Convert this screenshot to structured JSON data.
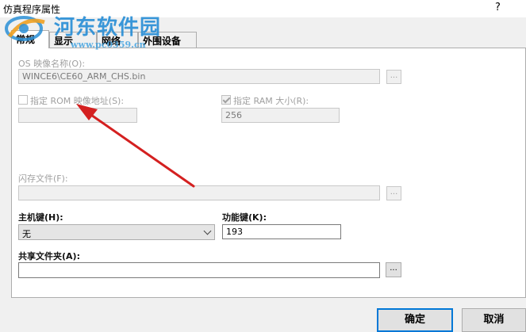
{
  "window": {
    "title": "仿真程序属性",
    "help_label": "?"
  },
  "watermark": {
    "text": "河东软件园",
    "url": "www.pc0359.cn"
  },
  "tabs": [
    {
      "label": "常规",
      "active": true
    },
    {
      "label": "显示",
      "active": false
    },
    {
      "label": "网络",
      "active": false
    },
    {
      "label": "外围设备",
      "active": false
    }
  ],
  "general": {
    "os_image_label": "OS 映像名称(O):",
    "os_image_value": "WINCE6\\CE60_ARM_CHS.bin",
    "browse_label": "...",
    "rom_checkbox_label": "指定 ROM 映像地址(S):",
    "rom_checked": false,
    "rom_value": "",
    "ram_checkbox_label": "指定 RAM 大小(R):",
    "ram_checked": true,
    "ram_value": "256",
    "flash_label": "闪存文件(F):",
    "flash_value": "",
    "host_key_label": "主机键(H):",
    "host_key_value": "无",
    "function_key_label": "功能键(K):",
    "function_key_value": "193",
    "shared_folder_label": "共享文件夹(A):",
    "shared_folder_value": ""
  },
  "buttons": {
    "ok_label": "确定",
    "cancel_label": "取消"
  },
  "colors": {
    "accent": "#0078d7",
    "annotation_arrow": "#d42020",
    "watermark": "#2a8fd6"
  }
}
